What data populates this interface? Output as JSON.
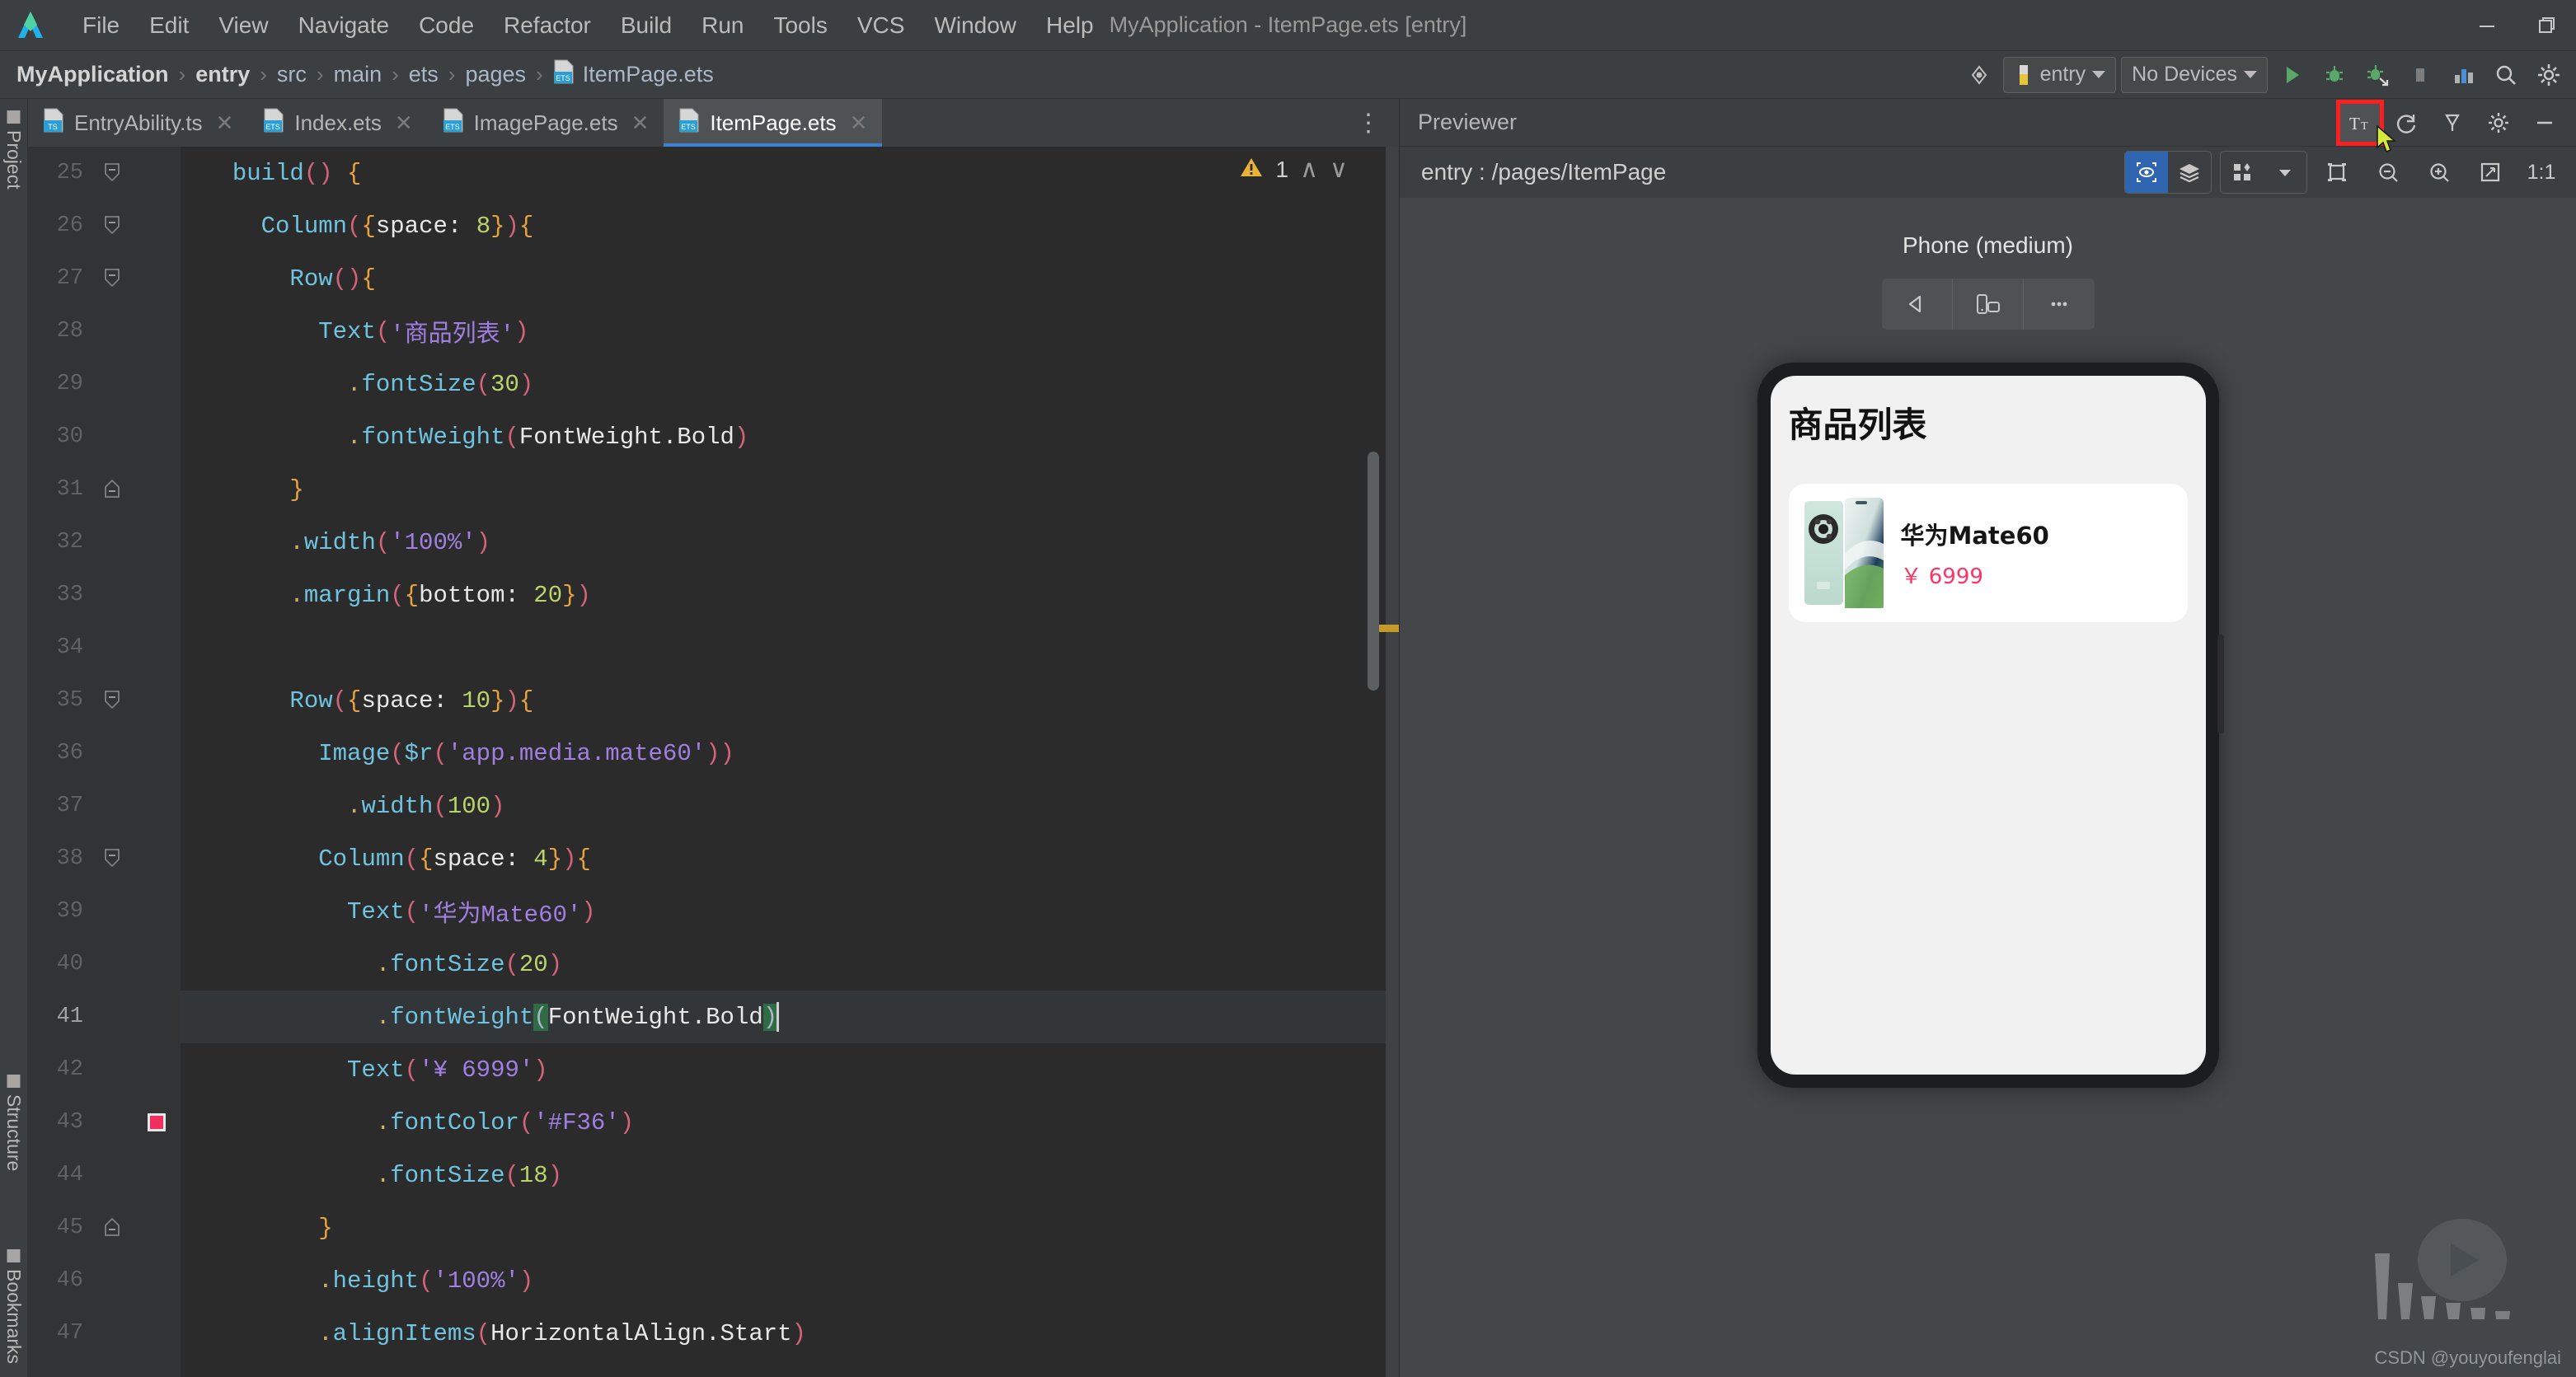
{
  "window": {
    "title": "MyApplication - ItemPage.ets [entry]",
    "logo_name": "deveco-studio-logo",
    "controls": [
      {
        "name": "minimize-button",
        "glyph": "–"
      },
      {
        "name": "restore-button",
        "glyph": "❐"
      }
    ]
  },
  "menubar": {
    "items": [
      {
        "label": "File"
      },
      {
        "label": "Edit"
      },
      {
        "label": "View"
      },
      {
        "label": "Navigate"
      },
      {
        "label": "Code"
      },
      {
        "label": "Refactor"
      },
      {
        "label": "Build"
      },
      {
        "label": "Run"
      },
      {
        "label": "Tools"
      },
      {
        "label": "VCS"
      },
      {
        "label": "Window"
      },
      {
        "label": "Help"
      }
    ]
  },
  "breadcrumb": {
    "items": [
      "MyApplication",
      "entry",
      "src",
      "main",
      "ets",
      "pages",
      "ItemPage.ets"
    ],
    "separator": "›",
    "file_icon": "ets-file-icon"
  },
  "toolbar": {
    "target_device_icon": "target-selector-icon",
    "run_config": "entry",
    "devices": "No Devices",
    "buttons": [
      {
        "name": "run-button",
        "label": "Run"
      },
      {
        "name": "debug-button",
        "label": "Debug"
      },
      {
        "name": "attach-debugger-button",
        "label": "Attach Debugger to Process"
      },
      {
        "name": "stop-button",
        "label": "Stop"
      },
      {
        "name": "device-manager-button",
        "label": "Device Manager"
      },
      {
        "name": "search-everywhere-button",
        "label": "Search Everywhere"
      },
      {
        "name": "settings-button",
        "label": "Settings"
      }
    ]
  },
  "sidebar": {
    "top": [
      {
        "label": "Project"
      }
    ],
    "bottom": [
      {
        "label": "Structure"
      },
      {
        "label": "Bookmarks"
      }
    ]
  },
  "tabs": [
    {
      "label": "EntryAbility.ts",
      "icon": "ts-file-icon",
      "active": false
    },
    {
      "label": "Index.ets",
      "icon": "ets-file-icon",
      "active": false
    },
    {
      "label": "ImagePage.ets",
      "icon": "ets-file-icon",
      "active": false
    },
    {
      "label": "ItemPage.ets",
      "icon": "ets-file-icon",
      "active": true
    }
  ],
  "editor": {
    "warning_count": "1",
    "first_line_number": 25,
    "current_line": 41,
    "breakpoint_line": 43,
    "lines": [
      {
        "n": 25,
        "fold": "open",
        "tokens": [
          {
            "t": "  ",
            "c": "pln"
          },
          {
            "t": "build",
            "c": "kw"
          },
          {
            "t": "()",
            "c": "par"
          },
          {
            "t": " ",
            "c": "pln"
          },
          {
            "t": "{",
            "c": "brc"
          }
        ]
      },
      {
        "n": 26,
        "fold": "open",
        "tokens": [
          {
            "t": "    ",
            "c": "pln"
          },
          {
            "t": "Column",
            "c": "kw"
          },
          {
            "t": "(",
            "c": "par"
          },
          {
            "t": "{",
            "c": "brc"
          },
          {
            "t": "space: ",
            "c": "pln"
          },
          {
            "t": "8",
            "c": "num"
          },
          {
            "t": "}",
            "c": "brc"
          },
          {
            "t": ")",
            "c": "par"
          },
          {
            "t": "{",
            "c": "brc"
          }
        ]
      },
      {
        "n": 27,
        "fold": "open",
        "tokens": [
          {
            "t": "      ",
            "c": "pln"
          },
          {
            "t": "Row",
            "c": "kw"
          },
          {
            "t": "()",
            "c": "par"
          },
          {
            "t": "{",
            "c": "brc"
          }
        ]
      },
      {
        "n": 28,
        "fold": "",
        "tokens": [
          {
            "t": "        ",
            "c": "pln"
          },
          {
            "t": "Text",
            "c": "kw"
          },
          {
            "t": "(",
            "c": "par"
          },
          {
            "t": "'商品列表'",
            "c": "str"
          },
          {
            "t": ")",
            "c": "par"
          }
        ]
      },
      {
        "n": 29,
        "fold": "",
        "tokens": [
          {
            "t": "          ",
            "c": "pln"
          },
          {
            "t": ".",
            "c": "dot"
          },
          {
            "t": "fontSize",
            "c": "kw"
          },
          {
            "t": "(",
            "c": "par"
          },
          {
            "t": "30",
            "c": "num"
          },
          {
            "t": ")",
            "c": "par"
          }
        ]
      },
      {
        "n": 30,
        "fold": "",
        "tokens": [
          {
            "t": "          ",
            "c": "pln"
          },
          {
            "t": ".",
            "c": "dot"
          },
          {
            "t": "fontWeight",
            "c": "kw"
          },
          {
            "t": "(",
            "c": "par"
          },
          {
            "t": "FontWeight.Bold",
            "c": "pln"
          },
          {
            "t": ")",
            "c": "par"
          }
        ]
      },
      {
        "n": 31,
        "fold": "close",
        "tokens": [
          {
            "t": "      ",
            "c": "pln"
          },
          {
            "t": "}",
            "c": "brc"
          }
        ]
      },
      {
        "n": 32,
        "fold": "",
        "tokens": [
          {
            "t": "      ",
            "c": "pln"
          },
          {
            "t": ".",
            "c": "dot"
          },
          {
            "t": "width",
            "c": "kw"
          },
          {
            "t": "(",
            "c": "par"
          },
          {
            "t": "'100%'",
            "c": "str"
          },
          {
            "t": ")",
            "c": "par"
          }
        ]
      },
      {
        "n": 33,
        "fold": "",
        "tokens": [
          {
            "t": "      ",
            "c": "pln"
          },
          {
            "t": ".",
            "c": "dot"
          },
          {
            "t": "margin",
            "c": "kw"
          },
          {
            "t": "(",
            "c": "par"
          },
          {
            "t": "{",
            "c": "brc"
          },
          {
            "t": "bottom: ",
            "c": "pln"
          },
          {
            "t": "20",
            "c": "num"
          },
          {
            "t": "}",
            "c": "brc"
          },
          {
            "t": ")",
            "c": "par"
          }
        ]
      },
      {
        "n": 34,
        "fold": "",
        "tokens": []
      },
      {
        "n": 35,
        "fold": "open",
        "tokens": [
          {
            "t": "      ",
            "c": "pln"
          },
          {
            "t": "Row",
            "c": "kw"
          },
          {
            "t": "(",
            "c": "par"
          },
          {
            "t": "{",
            "c": "brc"
          },
          {
            "t": "space: ",
            "c": "pln"
          },
          {
            "t": "10",
            "c": "num"
          },
          {
            "t": "}",
            "c": "brc"
          },
          {
            "t": ")",
            "c": "par"
          },
          {
            "t": "{",
            "c": "brc"
          }
        ]
      },
      {
        "n": 36,
        "fold": "",
        "tokens": [
          {
            "t": "        ",
            "c": "pln"
          },
          {
            "t": "Image",
            "c": "kw"
          },
          {
            "t": "(",
            "c": "par"
          },
          {
            "t": "$r",
            "c": "kw"
          },
          {
            "t": "(",
            "c": "par"
          },
          {
            "t": "'app.media.mate60'",
            "c": "str"
          },
          {
            "t": ")",
            "c": "par"
          },
          {
            "t": ")",
            "c": "par"
          }
        ]
      },
      {
        "n": 37,
        "fold": "",
        "tokens": [
          {
            "t": "          ",
            "c": "pln"
          },
          {
            "t": ".",
            "c": "dot"
          },
          {
            "t": "width",
            "c": "kw"
          },
          {
            "t": "(",
            "c": "par"
          },
          {
            "t": "100",
            "c": "num"
          },
          {
            "t": ")",
            "c": "par"
          }
        ]
      },
      {
        "n": 38,
        "fold": "open",
        "tokens": [
          {
            "t": "        ",
            "c": "pln"
          },
          {
            "t": "Column",
            "c": "kw"
          },
          {
            "t": "(",
            "c": "par"
          },
          {
            "t": "{",
            "c": "brc"
          },
          {
            "t": "space: ",
            "c": "pln"
          },
          {
            "t": "4",
            "c": "num"
          },
          {
            "t": "}",
            "c": "brc"
          },
          {
            "t": ")",
            "c": "par"
          },
          {
            "t": "{",
            "c": "brc"
          }
        ]
      },
      {
        "n": 39,
        "fold": "",
        "tokens": [
          {
            "t": "          ",
            "c": "pln"
          },
          {
            "t": "Text",
            "c": "kw"
          },
          {
            "t": "(",
            "c": "par"
          },
          {
            "t": "'华为Mate60'",
            "c": "str"
          },
          {
            "t": ")",
            "c": "par"
          }
        ]
      },
      {
        "n": 40,
        "fold": "",
        "tokens": [
          {
            "t": "            ",
            "c": "pln"
          },
          {
            "t": ".",
            "c": "dot"
          },
          {
            "t": "fontSize",
            "c": "kw"
          },
          {
            "t": "(",
            "c": "par"
          },
          {
            "t": "20",
            "c": "num"
          },
          {
            "t": ")",
            "c": "par"
          }
        ]
      },
      {
        "n": 41,
        "fold": "",
        "current": true,
        "tokens": [
          {
            "t": "            ",
            "c": "pln"
          },
          {
            "t": ".",
            "c": "dot"
          },
          {
            "t": "fontWeight",
            "c": "kw"
          },
          {
            "t": "(",
            "c": "bmatch"
          },
          {
            "t": "FontWeight.Bold",
            "c": "pln"
          },
          {
            "t": ")",
            "c": "bmatch"
          }
        ]
      },
      {
        "n": 42,
        "fold": "",
        "tokens": [
          {
            "t": "          ",
            "c": "pln"
          },
          {
            "t": "Text",
            "c": "kw"
          },
          {
            "t": "(",
            "c": "par"
          },
          {
            "t": "'¥ 6999'",
            "c": "str"
          },
          {
            "t": ")",
            "c": "par"
          }
        ]
      },
      {
        "n": 43,
        "fold": "",
        "mark": true,
        "tokens": [
          {
            "t": "            ",
            "c": "pln"
          },
          {
            "t": ".",
            "c": "dot"
          },
          {
            "t": "fontColor",
            "c": "kw"
          },
          {
            "t": "(",
            "c": "par"
          },
          {
            "t": "'#F36'",
            "c": "str"
          },
          {
            "t": ")",
            "c": "par"
          }
        ]
      },
      {
        "n": 44,
        "fold": "",
        "tokens": [
          {
            "t": "            ",
            "c": "pln"
          },
          {
            "t": ".",
            "c": "dot"
          },
          {
            "t": "fontSize",
            "c": "kw"
          },
          {
            "t": "(",
            "c": "par"
          },
          {
            "t": "18",
            "c": "num"
          },
          {
            "t": ")",
            "c": "par"
          }
        ]
      },
      {
        "n": 45,
        "fold": "close",
        "tokens": [
          {
            "t": "        ",
            "c": "pln"
          },
          {
            "t": "}",
            "c": "brc"
          }
        ]
      },
      {
        "n": 46,
        "fold": "",
        "tokens": [
          {
            "t": "        ",
            "c": "pln"
          },
          {
            "t": ".",
            "c": "dot"
          },
          {
            "t": "height",
            "c": "kw"
          },
          {
            "t": "(",
            "c": "par"
          },
          {
            "t": "'100%'",
            "c": "str"
          },
          {
            "t": ")",
            "c": "par"
          }
        ]
      },
      {
        "n": 47,
        "fold": "",
        "tokens": [
          {
            "t": "        ",
            "c": "pln"
          },
          {
            "t": ".",
            "c": "dot"
          },
          {
            "t": "alignItems",
            "c": "kw"
          },
          {
            "t": "(",
            "c": "par"
          },
          {
            "t": "HorizontalAlign.Start",
            "c": "pln"
          },
          {
            "t": ")",
            "c": "par"
          }
        ]
      }
    ]
  },
  "previewer": {
    "title": "Previewer",
    "path": "entry : /pages/ItemPage",
    "header_icons": [
      {
        "name": "text-size-icon",
        "glyph": "Tᴛ",
        "highlighted": true
      },
      {
        "name": "refresh-icon",
        "glyph": "↻",
        "highlighted": false
      },
      {
        "name": "plug-icon",
        "glyph": "✇",
        "highlighted": false
      },
      {
        "name": "settings-gear-icon",
        "glyph": "⚙",
        "highlighted": false
      },
      {
        "name": "collapse-icon",
        "glyph": "—",
        "highlighted": false
      }
    ],
    "sub_icons": [
      {
        "name": "inspector-icon",
        "active": true
      },
      {
        "name": "layers-icon",
        "active": false
      },
      {
        "name": "multi-device-icon",
        "active": false
      },
      {
        "name": "device-dropdown-icon",
        "active": false
      },
      {
        "name": "frame-icon",
        "active": false
      },
      {
        "name": "zoom-out-icon",
        "active": false
      },
      {
        "name": "zoom-in-icon",
        "active": false
      },
      {
        "name": "fit-screen-icon",
        "active": false
      },
      {
        "name": "actual-size-icon",
        "active": false
      }
    ],
    "zoom_label": "1:1",
    "device": {
      "name": "Phone (medium)",
      "controls": [
        {
          "name": "back-button",
          "glyph": "◁"
        },
        {
          "name": "rotate-button",
          "glyph": "rotate"
        },
        {
          "name": "more-button",
          "glyph": "…"
        }
      ]
    },
    "page": {
      "title": "商品列表",
      "items": [
        {
          "name": "华为Mate60",
          "price": "￥ 6999",
          "price_color": "#ff3366",
          "image": "mate60-product-image"
        }
      ]
    }
  },
  "watermark": {
    "text": "CSDN @youyoufenglai"
  }
}
